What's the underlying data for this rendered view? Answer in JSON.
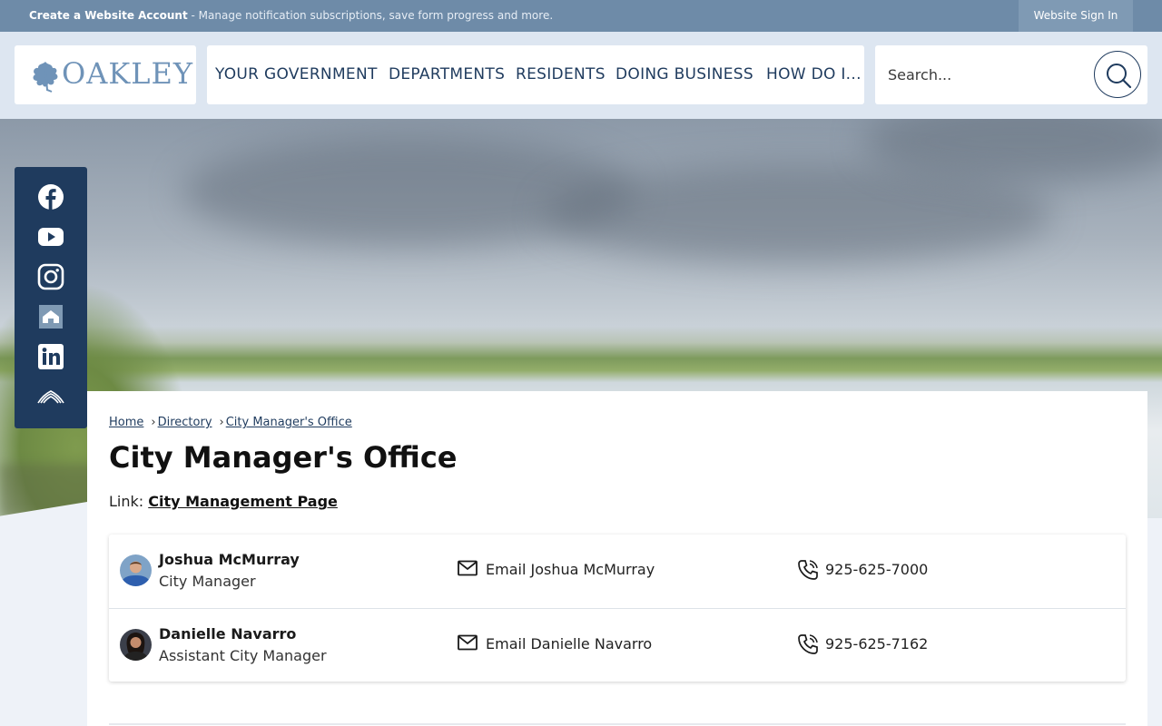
{
  "topbar": {
    "create_account": "Create a Website Account",
    "message": " - Manage notification subscriptions, save form progress and more.",
    "sign_in": "Website Sign In"
  },
  "header": {
    "logo_text": "OAKLEY",
    "nav": [
      "YOUR GOVERNMENT",
      "DEPARTMENTS",
      "RESIDENTS",
      "DOING BUSINESS",
      "HOW DO I..."
    ],
    "search_placeholder": "Search..."
  },
  "social": {
    "icons": [
      "facebook-icon",
      "youtube-icon",
      "instagram-icon",
      "nextdoor-icon",
      "linkedin-icon",
      "city-app-icon"
    ],
    "color": "#1f3b5e"
  },
  "breadcrumb": [
    "Home",
    "Directory",
    "City Manager's Office"
  ],
  "page_title": "City Manager's Office",
  "link_line": {
    "label": "Link: ",
    "text": "City Management Page"
  },
  "staff": [
    {
      "name": "Joshua McMurray",
      "title": "City Manager",
      "email_label": "Email Joshua McMurray",
      "phone": "925-625-7000"
    },
    {
      "name": "Danielle Navarro",
      "title": "Assistant City Manager",
      "email_label": "Email Danielle Navarro",
      "phone": "925-625-7162"
    }
  ],
  "colors": {
    "navy": "#1f3b5e",
    "topbar": "#6e8ba8",
    "logo": "#6f93b8"
  }
}
